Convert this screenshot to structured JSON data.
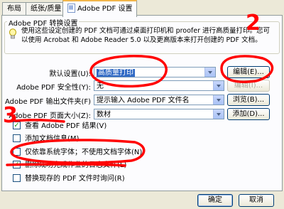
{
  "tabs": [
    {
      "label": "布局"
    },
    {
      "label": "纸张/质量"
    },
    {
      "label": "Adobe PDF 设置"
    }
  ],
  "group": {
    "title": "Adobe PDF 转换设置",
    "description": "使用这些设定创建的 PDF 文档可通过桌面打印机和 proofer 进行高质量打印。您可以使用 Acrobat 和 Adobe Reader 5.0 以及更高版本来打开创建的 PDF 文档。"
  },
  "fields": {
    "default_settings": {
      "label": "默认设置(U):",
      "value": "高质量打印",
      "button": "编辑(E)..."
    },
    "security": {
      "label": "Adobe PDF 安全性(Y):",
      "value": "无",
      "button": "编辑(I)..."
    },
    "output_folder": {
      "label": "Adobe PDF 输出文件夹(F)",
      "value": "提示输入 Adobe PDF 文件名",
      "button": "浏览(B)..."
    },
    "page_size": {
      "label": "Adobe PDF 页面大小(Z):",
      "value": "数材",
      "button": "添加(D)..."
    }
  },
  "checkboxes": [
    {
      "label": "查看 Adobe PDF 结果(V)",
      "checked": true
    },
    {
      "label": "添加文档信息(M)",
      "checked": false
    },
    {
      "label": "仅依靠系统字体；不使用文档字体(N)",
      "checked": false
    },
    {
      "label": "删除成功完成作业的日志文件(L)",
      "checked": true
    },
    {
      "label": "替换现存的 PDF 文件时询问(R)",
      "checked": false
    }
  ],
  "check_glyph": "✓",
  "footer": {
    "ok": "确定",
    "cancel": "取消"
  },
  "annotations": {
    "step2": "2",
    "step3": "3"
  },
  "colors": {
    "highlight": "#316ac5",
    "annotation_red": "#ff0000",
    "tab_accent": "#f2b64a"
  }
}
